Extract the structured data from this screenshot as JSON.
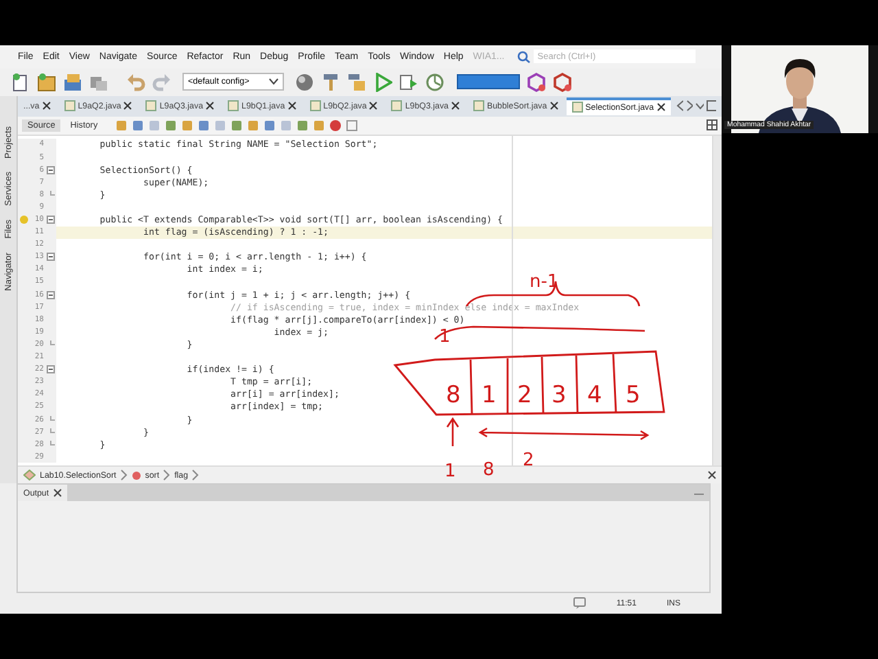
{
  "menu_bar": {
    "items": [
      "File",
      "Edit",
      "View",
      "Navigate",
      "Source",
      "Refactor",
      "Run",
      "Debug",
      "Profile",
      "Team",
      "Tools",
      "Window",
      "Help"
    ],
    "project_label": "WIA1...",
    "search": {
      "placeholder": "Search (Ctrl+I)"
    }
  },
  "toolbar": {
    "config": "<default config>"
  },
  "side_tabs": [
    "Projects",
    "Services",
    "Files",
    "Navigator"
  ],
  "tabs": [
    {
      "label": "...va",
      "selected": false
    },
    {
      "label": "L9aQ2.java",
      "selected": false
    },
    {
      "label": "L9aQ3.java",
      "selected": false
    },
    {
      "label": "L9bQ1.java",
      "selected": false
    },
    {
      "label": "L9bQ2.java",
      "selected": false
    },
    {
      "label": "L9bQ3.java",
      "selected": false
    },
    {
      "label": "BubbleSort.java",
      "selected": false
    },
    {
      "label": "SelectionSort.java",
      "selected": true
    }
  ],
  "editor_modes": [
    {
      "label": "Source",
      "selected": true
    },
    {
      "label": "History",
      "selected": false
    }
  ],
  "lines": [
    {
      "n": "4",
      "text": "        public static final String NAME = \"Selection Sort\";",
      "kind": "code",
      "fold_start": false,
      "fold_end": false,
      "current": false,
      "hint": false
    },
    {
      "n": "5",
      "fold_start": false,
      "fold_end": false,
      "current": false,
      "hint": false
    },
    {
      "n": "6",
      "text": "        SelectionSort() {",
      "kind": "code",
      "fold_start": true,
      "fold_end": false,
      "current": false,
      "hint": false
    },
    {
      "n": "7",
      "text": "                super(NAME);",
      "kind": "code",
      "fold_start": false,
      "fold_end": false,
      "current": false,
      "hint": false
    },
    {
      "n": "8",
      "text": "        }",
      "kind": "code",
      "fold_start": false,
      "fold_end": true,
      "current": false,
      "hint": false
    },
    {
      "n": "9",
      "fold_start": false,
      "fold_end": false,
      "current": false,
      "hint": false
    },
    {
      "n": "10",
      "text": "        public <T extends Comparable<T>> void sort(T[] arr, boolean isAscending) {",
      "kind": "code",
      "fold_start": true,
      "fold_end": false,
      "current": false,
      "hint": true
    },
    {
      "n": "11",
      "text": "                int flag = (isAscending) ? 1 : -1;",
      "kind": "code",
      "fold_start": false,
      "fold_end": false,
      "current": true,
      "hint": false
    },
    {
      "n": "12",
      "fold_start": false,
      "fold_end": false,
      "current": false,
      "hint": false
    },
    {
      "n": "13",
      "text": "                for(int i = 0; i < arr.length - 1; i++) {",
      "kind": "code",
      "fold_start": true,
      "fold_end": false,
      "current": false,
      "hint": false
    },
    {
      "n": "14",
      "text": "                        int index = i;",
      "kind": "code",
      "fold_start": false,
      "fold_end": false,
      "current": false,
      "hint": false
    },
    {
      "n": "15",
      "fold_start": false,
      "fold_end": false,
      "current": false,
      "hint": false
    },
    {
      "n": "16",
      "text": "                        for(int j = 1 + i; j < arr.length; j++) {",
      "kind": "code",
      "fold_start": true,
      "fold_end": false,
      "current": false,
      "hint": false
    },
    {
      "n": "17",
      "text": "                                // if isAscending = true, index = minIndex else index = maxIndex",
      "kind": "comment",
      "fold_start": false,
      "fold_end": false,
      "current": false,
      "hint": false
    },
    {
      "n": "18",
      "text": "                                if(flag * arr[j].compareTo(arr[index]) < 0)",
      "kind": "code",
      "fold_start": false,
      "fold_end": false,
      "current": false,
      "hint": false
    },
    {
      "n": "19",
      "text": "                                        index = j;",
      "kind": "code",
      "fold_start": false,
      "fold_end": false,
      "current": false,
      "hint": false
    },
    {
      "n": "20",
      "text": "                        }",
      "kind": "code",
      "fold_start": false,
      "fold_end": true,
      "current": false,
      "hint": false
    },
    {
      "n": "21",
      "fold_start": false,
      "fold_end": false,
      "current": false,
      "hint": false
    },
    {
      "n": "22",
      "text": "                        if(index != i) {",
      "kind": "code",
      "fold_start": true,
      "fold_end": false,
      "current": false,
      "hint": false
    },
    {
      "n": "23",
      "text": "                                T tmp = arr[i];",
      "kind": "code",
      "fold_start": false,
      "fold_end": false,
      "current": false,
      "hint": false
    },
    {
      "n": "24",
      "text": "                                arr[i] = arr[index];",
      "kind": "code",
      "fold_start": false,
      "fold_end": false,
      "current": false,
      "hint": false
    },
    {
      "n": "25",
      "text": "                                arr[index] = tmp;",
      "kind": "code",
      "fold_start": false,
      "fold_end": false,
      "current": false,
      "hint": false
    },
    {
      "n": "26",
      "text": "                        }",
      "kind": "code",
      "fold_start": false,
      "fold_end": true,
      "current": false,
      "hint": false
    },
    {
      "n": "27",
      "text": "                }",
      "kind": "code",
      "fold_start": false,
      "fold_end": true,
      "current": false,
      "hint": false
    },
    {
      "n": "28",
      "text": "        }",
      "kind": "code",
      "fold_start": false,
      "fold_end": true,
      "current": false,
      "hint": false
    },
    {
      "n": "29",
      "fold_start": false,
      "fold_end": false,
      "current": false,
      "hint": false
    }
  ],
  "annotation": {
    "top_label": "n-1",
    "marker": "1",
    "cells": [
      "8",
      "1",
      "2",
      "3",
      "4",
      "5"
    ],
    "bottom_labels": [
      "1",
      "8",
      "2"
    ]
  },
  "breadcrumbs": [
    "Lab10.SelectionSort",
    "sort",
    "flag"
  ],
  "output_panel": {
    "tab": "Output"
  },
  "status_bar": {
    "position": "11:51",
    "mode": "INS"
  },
  "webcam": {
    "name": "Mohammad Shahid Akhtar"
  }
}
